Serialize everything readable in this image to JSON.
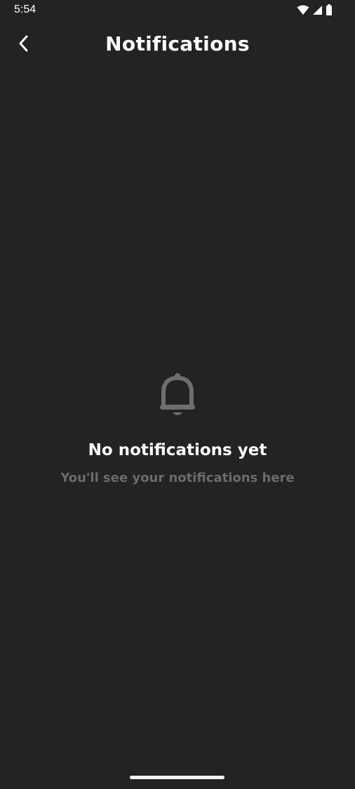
{
  "status_bar": {
    "time": "5:54",
    "icons": [
      "wifi-icon",
      "cellular-signal-icon",
      "battery-icon"
    ]
  },
  "app_bar": {
    "title": "Notifications",
    "back_icon": "chevron-left-icon"
  },
  "empty_state": {
    "icon": "bell-icon",
    "title": "No notifications yet",
    "subtitle": "You'll see your notifications here"
  },
  "colors": {
    "background": "#232323",
    "text_primary": "#ffffff",
    "text_secondary": "#6b6b6b",
    "icon_muted": "#6e6e6e"
  }
}
